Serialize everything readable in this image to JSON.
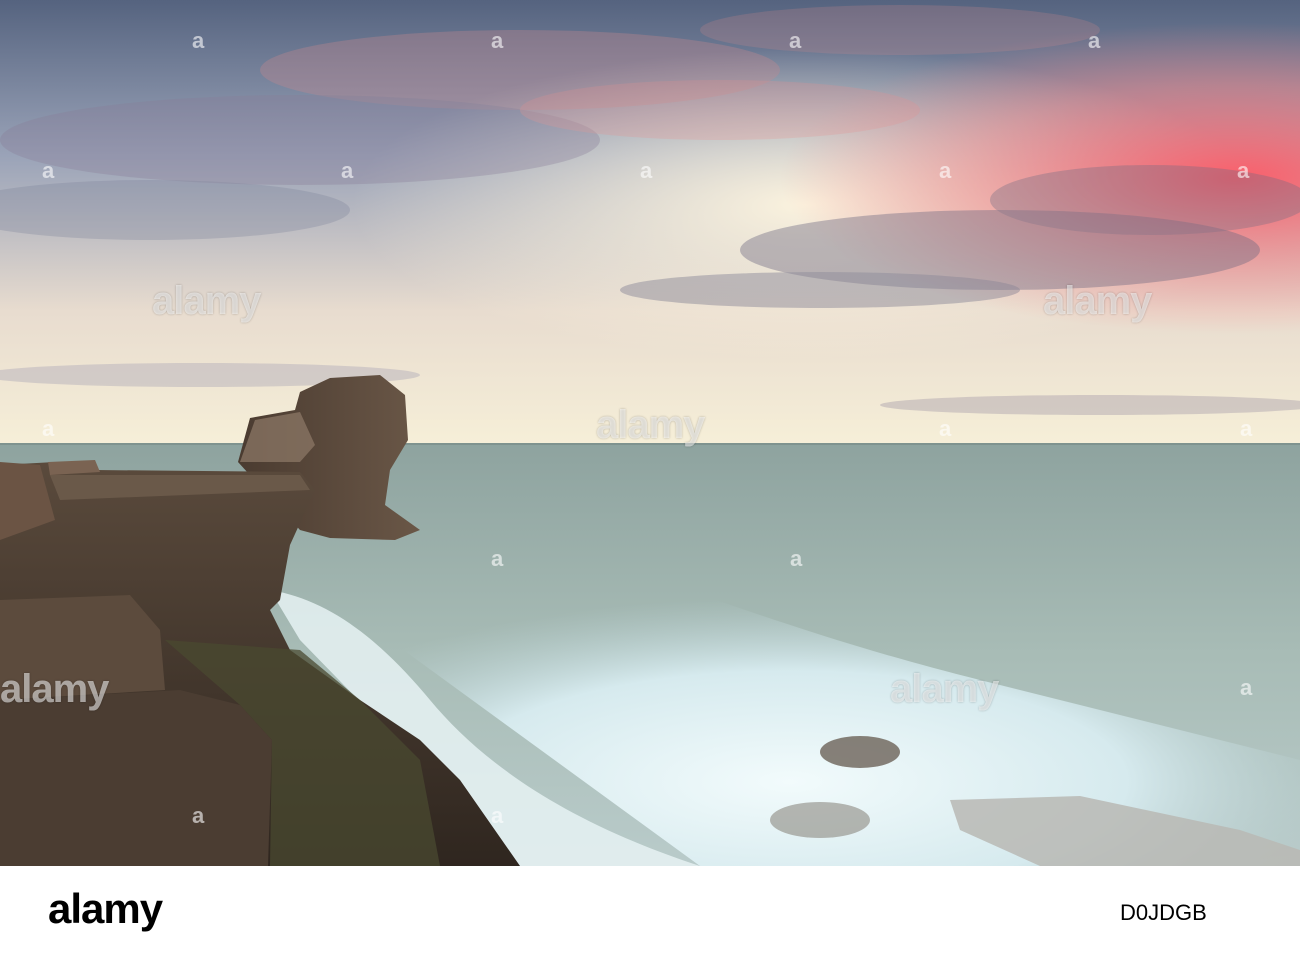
{
  "watermarks": {
    "brand": "alamy",
    "tile_marks": [
      "a",
      "a",
      "a",
      "a",
      "a",
      "a",
      "a",
      "a",
      "a",
      "a",
      "a",
      "a",
      "a",
      "a",
      "a",
      "a",
      "a"
    ]
  },
  "footer": {
    "logo": "alamy",
    "image_id": "D0JDGB"
  },
  "colors": {
    "sky_top": "#5f6f8f",
    "sunset_pink": "#ff6a70",
    "horizon_glow": "#f6f0d8",
    "sea": "#9fb3ad",
    "surf": "#e8f4f6",
    "rock": "#3d3128"
  }
}
